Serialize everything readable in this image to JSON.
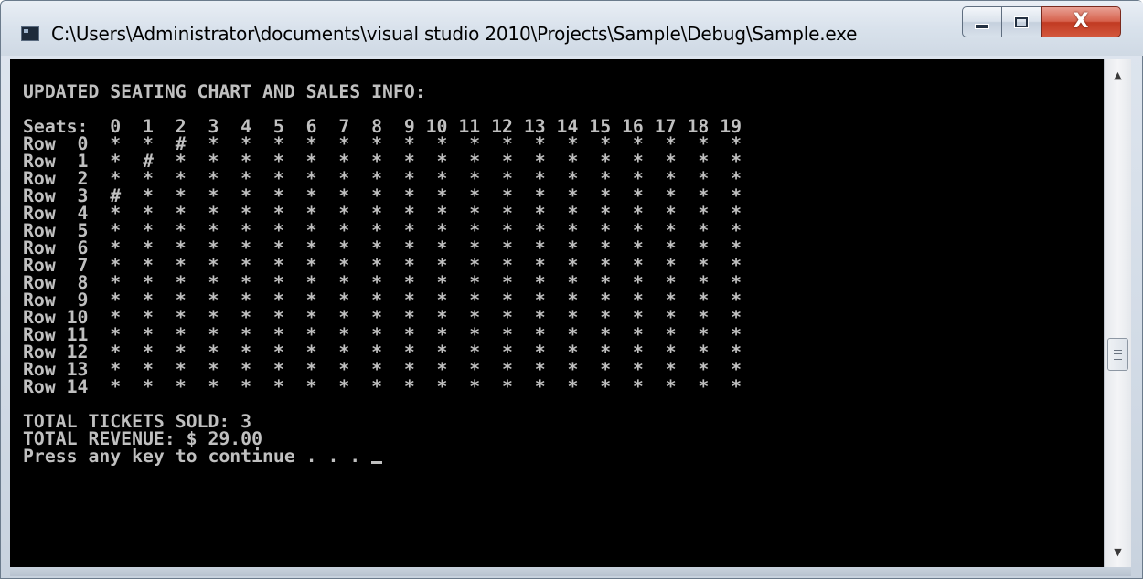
{
  "window": {
    "title": "C:\\Users\\Administrator\\documents\\visual studio 2010\\Projects\\Sample\\Debug\\Sample.exe",
    "close_glyph": "X",
    "icons": [
      "console-app-icon",
      "minimize-icon",
      "maximize-icon",
      "close-icon",
      "scroll-up-arrow-icon",
      "scroll-down-arrow-icon"
    ]
  },
  "console": {
    "heading": "UPDATED SEATING CHART AND SALES INFO:",
    "header_line": "Seats:  0  1  2  3  4  5  6  7  8  9 10 11 12 13 14 15 16 17 18 19",
    "rows": [
      "Row  0  *  *  #  *  *  *  *  *  *  *  *  *  *  *  *  *  *  *  *  *",
      "Row  1  *  #  *  *  *  *  *  *  *  *  *  *  *  *  *  *  *  *  *  *",
      "Row  2  *  *  *  *  *  *  *  *  *  *  *  *  *  *  *  *  *  *  *  *",
      "Row  3  #  *  *  *  *  *  *  *  *  *  *  *  *  *  *  *  *  *  *  *",
      "Row  4  *  *  *  *  *  *  *  *  *  *  *  *  *  *  *  *  *  *  *  *",
      "Row  5  *  *  *  *  *  *  *  *  *  *  *  *  *  *  *  *  *  *  *  *",
      "Row  6  *  *  *  *  *  *  *  *  *  *  *  *  *  *  *  *  *  *  *  *",
      "Row  7  *  *  *  *  *  *  *  *  *  *  *  *  *  *  *  *  *  *  *  *",
      "Row  8  *  *  *  *  *  *  *  *  *  *  *  *  *  *  *  *  *  *  *  *",
      "Row  9  *  *  *  *  *  *  *  *  *  *  *  *  *  *  *  *  *  *  *  *",
      "Row 10  *  *  *  *  *  *  *  *  *  *  *  *  *  *  *  *  *  *  *  *",
      "Row 11  *  *  *  *  *  *  *  *  *  *  *  *  *  *  *  *  *  *  *  *",
      "Row 12  *  *  *  *  *  *  *  *  *  *  *  *  *  *  *  *  *  *  *  *",
      "Row 13  *  *  *  *  *  *  *  *  *  *  *  *  *  *  *  *  *  *  *  *",
      "Row 14  *  *  *  *  *  *  *  *  *  *  *  *  *  *  *  *  *  *  *  *"
    ],
    "total_tickets": "TOTAL TICKETS SOLD: 3",
    "total_revenue": "TOTAL REVENUE: $ 29.00",
    "prompt": "Press any key to continue . . . "
  },
  "colors": {
    "console_background": "#000000",
    "console_text": "#c0c0c0",
    "close_button": "#c7432b"
  }
}
